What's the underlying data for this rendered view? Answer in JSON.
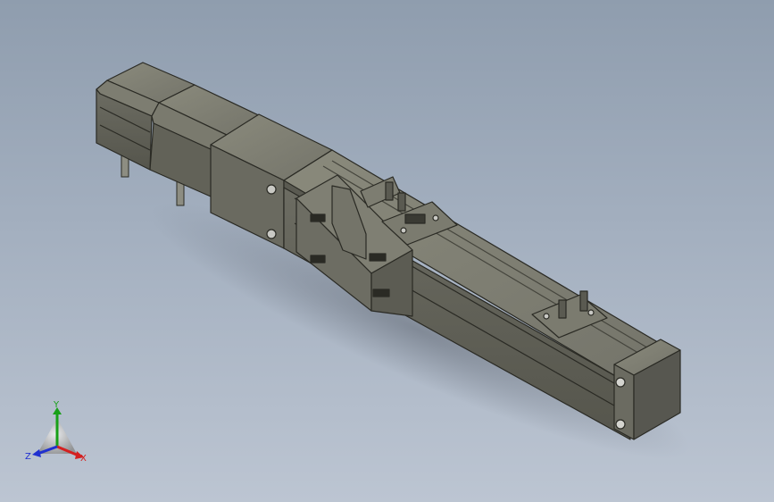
{
  "viewport": {
    "title": "",
    "background_top": "#8f9dae",
    "background_bottom": "#bcc5d2"
  },
  "model": {
    "name": "linear-actuator-assembly",
    "body_color": "#6f6e62",
    "edge_color": "#2a2a24"
  },
  "triad": {
    "x_label": "X",
    "y_label": "Y",
    "z_label": "Z",
    "x_color": "#d42020",
    "y_color": "#18a018",
    "z_color": "#2030d0"
  }
}
